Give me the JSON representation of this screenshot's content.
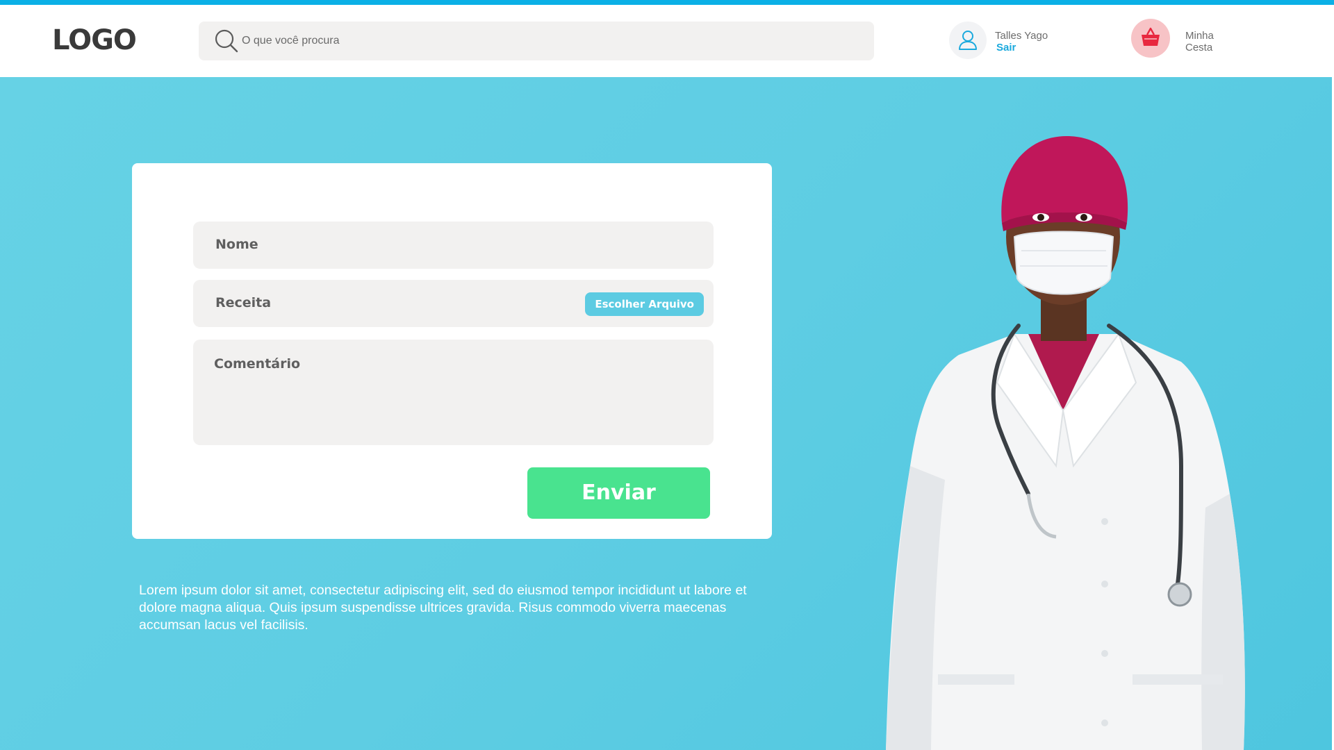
{
  "header": {
    "logo": "LOGO",
    "search": {
      "placeholder": "O que você procura",
      "icon": "search-icon"
    },
    "user": {
      "name": "Talles Yago",
      "logout": "Sair",
      "icon": "user-icon"
    },
    "cart": {
      "label": "Minha Cesta",
      "icon": "basket-icon"
    }
  },
  "form": {
    "name_label": "Nome",
    "prescription_label": "Receita",
    "file_button": "Escolher Arquivo",
    "comment_label": "Comentário",
    "submit": "Enviar"
  },
  "description": "Lorem ipsum dolor sit amet, consectetur adipiscing elit, sed do eiusmod tempor incididunt ut labore et dolore magna aliqua. Quis ipsum suspendisse ultrices gravida. Risus commodo viverra maecenas accumsan lacus vel facilisis.",
  "colors": {
    "accent": "#0bb0e6",
    "hero_background": "#5ecde3",
    "submit": "#49e38f",
    "file_button": "#5ccbe2",
    "field_background": "#f2f1f0"
  }
}
